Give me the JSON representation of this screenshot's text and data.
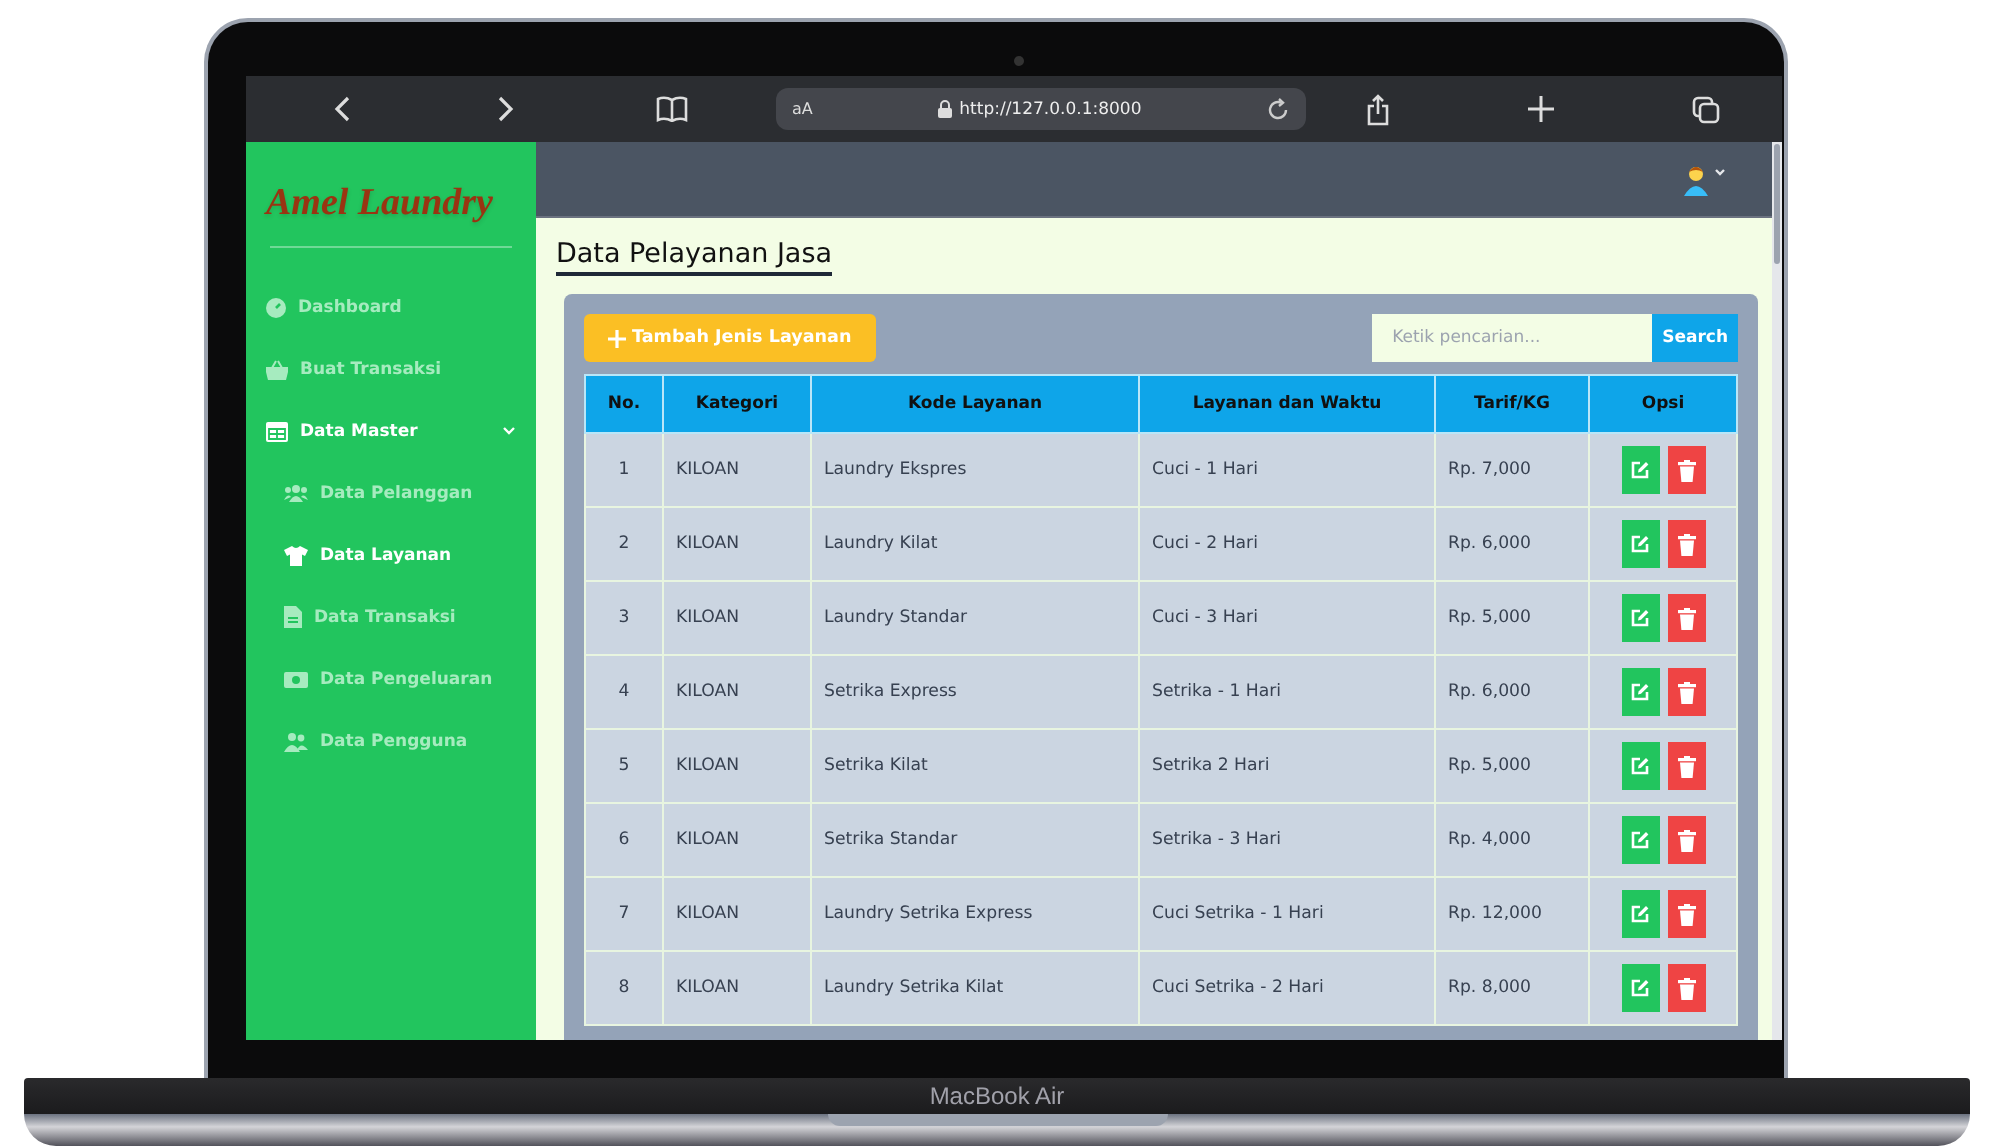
{
  "browser": {
    "text_size_label": "aA",
    "url": "http://127.0.0.1:8000"
  },
  "brand": "Amel Laundry",
  "sidebar": {
    "items": [
      {
        "label": "Dashboard",
        "selected": false
      },
      {
        "label": "Buat Transaksi",
        "selected": false
      },
      {
        "label": "Data Master",
        "selected": true,
        "expanded": true,
        "children": [
          {
            "label": "Data Pelanggan",
            "selected": false
          },
          {
            "label": "Data Layanan",
            "selected": true
          },
          {
            "label": "Data Transaksi",
            "selected": false
          },
          {
            "label": "Data Pengeluaran",
            "selected": false
          },
          {
            "label": "Data Pengguna",
            "selected": false
          }
        ]
      }
    ]
  },
  "page_title": "Data Pelayanan Jasa",
  "add_button": "Tambah Jenis Layanan",
  "search": {
    "placeholder": "Ketik pencarian...",
    "button": "Search"
  },
  "table": {
    "columns": [
      "No.",
      "Kategori",
      "Kode Layanan",
      "Layanan dan Waktu",
      "Tarif/KG",
      "Opsi"
    ],
    "rows": [
      [
        "1",
        "KILOAN",
        "Laundry Ekspres",
        "Cuci - 1 Hari",
        "Rp. 7,000"
      ],
      [
        "2",
        "KILOAN",
        "Laundry Kilat",
        "Cuci - 2 Hari",
        "Rp. 6,000"
      ],
      [
        "3",
        "KILOAN",
        "Laundry Standar",
        "Cuci - 3 Hari",
        "Rp. 5,000"
      ],
      [
        "4",
        "KILOAN",
        "Setrika Express",
        "Setrika - 1 Hari",
        "Rp. 6,000"
      ],
      [
        "5",
        "KILOAN",
        "Setrika Kilat",
        "Setrika 2 Hari",
        "Rp. 5,000"
      ],
      [
        "6",
        "KILOAN",
        "Setrika Standar",
        "Setrika - 3 Hari",
        "Rp. 4,000"
      ],
      [
        "7",
        "KILOAN",
        "Laundry Setrika Express",
        "Cuci Setrika - 1 Hari",
        "Rp. 12,000"
      ],
      [
        "8",
        "KILOAN",
        "Laundry Setrika Kilat",
        "Cuci Setrika - 2 Hari",
        "Rp. 8,000"
      ]
    ]
  },
  "device_label": "MacBook Air"
}
